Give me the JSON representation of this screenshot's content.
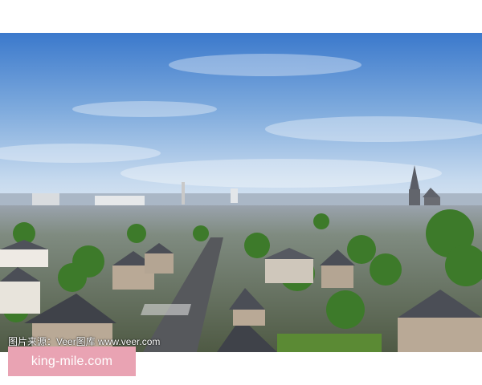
{
  "photo": {
    "subject": "aerial-town-view",
    "colors": {
      "sky_top": "#3f7fd0",
      "sky_mid": "#8fb6e0",
      "sky_horizon": "#c8dbef",
      "roof": "#4b4e56",
      "wall": "#b9a996",
      "tree": "#3d7a2a",
      "road": "#56585c"
    }
  },
  "caption": {
    "text": "图片来源：Veer图库 www.veer.com"
  },
  "watermark": {
    "text": "king-mile.com",
    "color": "#e9a3b3"
  }
}
